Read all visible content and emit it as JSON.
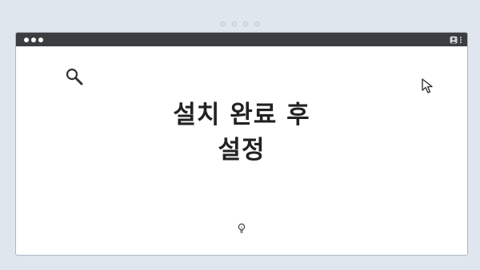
{
  "header": {
    "indicator_dots": 4
  },
  "window": {
    "titlebar": {
      "controls": [
        "dot",
        "dot",
        "dot"
      ],
      "icons": [
        "user-icon",
        "kebab-menu-icon"
      ]
    },
    "content": {
      "title_line1": "설치 완료 후",
      "title_line2": "설정",
      "icons": [
        "search-icon",
        "cursor-arrow-icon",
        "lightbulb-icon"
      ]
    }
  },
  "colors": {
    "background": "#dfe6ee",
    "titlebar": "#3b3d41",
    "window": "#ffffff",
    "text": "#222222"
  }
}
